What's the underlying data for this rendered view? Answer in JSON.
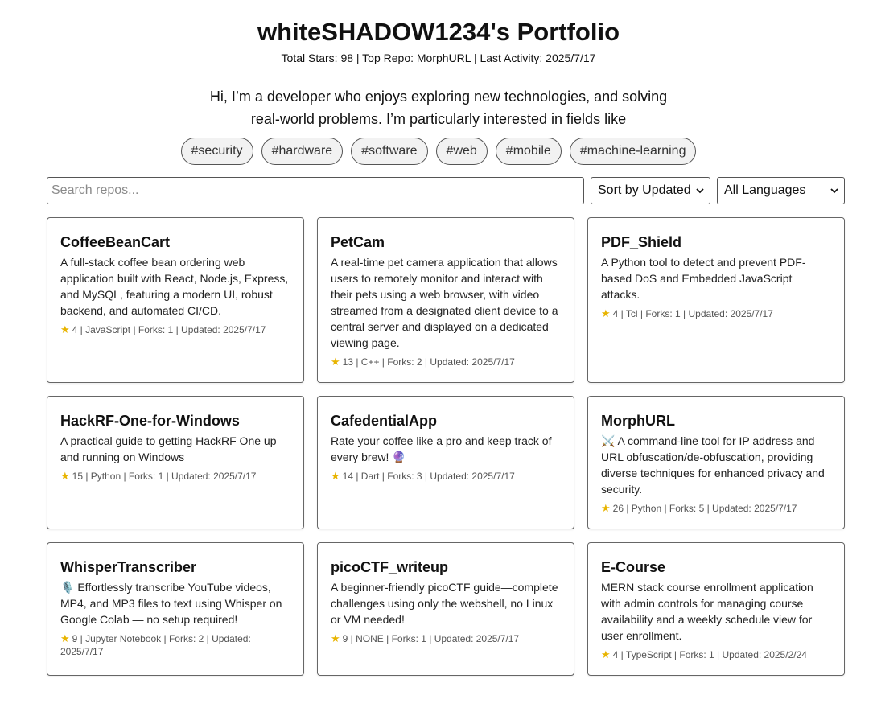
{
  "header": {
    "title": "whiteSHADOW1234's Portfolio",
    "stats": "Total Stars: 98 | Top Repo: MorphURL | Last Activity: 2025/7/17",
    "bio": "Hi, I’m a developer who enjoys exploring new technologies, and solving real-world problems. I’m particularly interested in fields like"
  },
  "tags": [
    "#security",
    "#hardware",
    "#software",
    "#web",
    "#mobile",
    "#machine-learning"
  ],
  "controls": {
    "search_placeholder": "Search repos...",
    "sort_selected": "Sort by Updated",
    "language_selected": "All Languages"
  },
  "repos": [
    {
      "name": "CoffeeBeanCart",
      "description": "A full-stack coffee bean ordering web application built with React, Node.js, Express, and MySQL, featuring a modern UI, robust backend, and automated CI/CD.",
      "meta": "4 | JavaScript | Forks: 1 | Updated: 2025/7/17"
    },
    {
      "name": "PetCam",
      "description": "A real-time pet camera application that allows users to remotely monitor and interact with their pets using a web browser, with video streamed from a designated client device to a central server and displayed on a dedicated viewing page.",
      "meta": "13 | C++ | Forks: 2 | Updated: 2025/7/17"
    },
    {
      "name": "PDF_Shield",
      "description": "A Python tool to detect and prevent PDF-based DoS and Embedded JavaScript attacks.",
      "meta": "4 | Tcl | Forks: 1 | Updated: 2025/7/17"
    },
    {
      "name": "HackRF-One-for-Windows",
      "description": "A practical guide to getting HackRF One up and running on Windows",
      "meta": "15 | Python | Forks: 1 | Updated: 2025/7/17"
    },
    {
      "name": "CafedentialApp",
      "description": "Rate your coffee like a pro and keep track of every brew! 🔮",
      "meta": "14 | Dart | Forks: 3 | Updated: 2025/7/17"
    },
    {
      "name": "MorphURL",
      "description": "⚔️ A command-line tool for IP address and URL obfuscation/de-obfuscation, providing diverse techniques for enhanced privacy and security.",
      "meta": "26 | Python | Forks: 5 | Updated: 2025/7/17"
    },
    {
      "name": "WhisperTranscriber",
      "description": "🎙️ Effortlessly transcribe YouTube videos, MP4, and MP3 files to text using Whisper on Google Colab — no setup required!",
      "meta": "9 | Jupyter Notebook | Forks: 2 | Updated: 2025/7/17"
    },
    {
      "name": "picoCTF_writeup",
      "description": "A beginner-friendly picoCTF guide—complete challenges using only the webshell, no Linux or VM needed!",
      "meta": "9 | NONE | Forks: 1 | Updated: 2025/7/17"
    },
    {
      "name": "E-Course",
      "description": "MERN stack course enrollment application with admin controls for managing course availability and a weekly schedule view for user enrollment.",
      "meta": "4 | TypeScript | Forks: 1 | Updated: 2025/2/24"
    }
  ],
  "colors": {
    "star": "#e8b400",
    "border": "#666666",
    "tag_bg": "#f2f2f2"
  }
}
